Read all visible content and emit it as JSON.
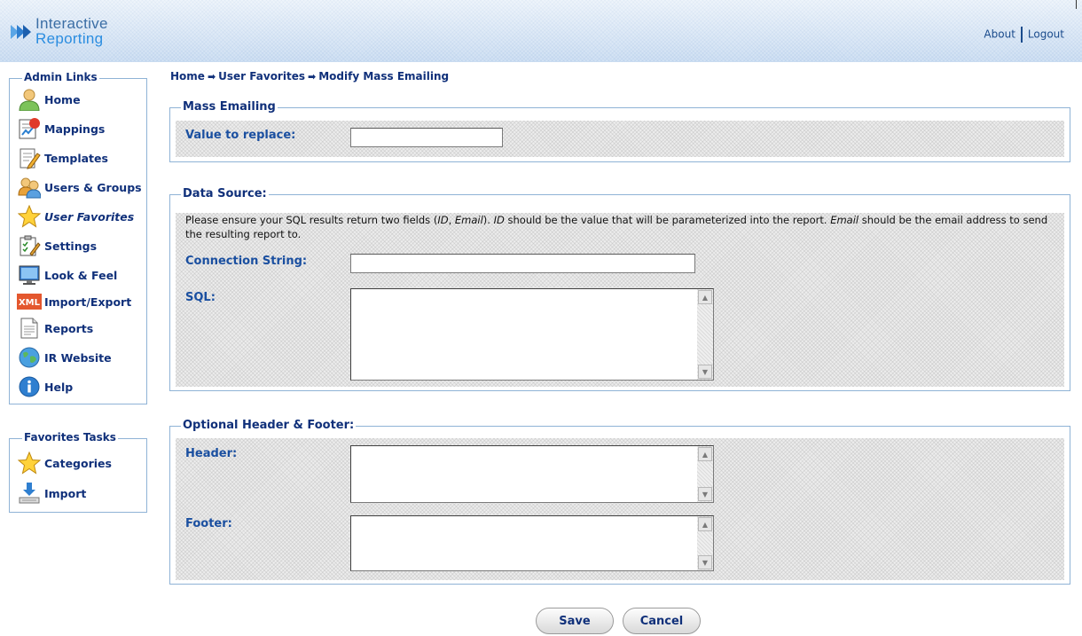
{
  "header": {
    "logo_line1": "Interactive",
    "logo_line2": "Reporting",
    "about": "About",
    "logout": "Logout"
  },
  "sidebar": {
    "admin_title": "Admin Links",
    "admin_items": [
      {
        "label": "Home",
        "icon": "user-icon"
      },
      {
        "label": "Mappings",
        "icon": "mappings-icon"
      },
      {
        "label": "Templates",
        "icon": "templates-icon"
      },
      {
        "label": "Users & Groups",
        "icon": "users-groups-icon"
      },
      {
        "label": "User Favorites",
        "icon": "star-icon",
        "active": true
      },
      {
        "label": "Settings",
        "icon": "settings-icon"
      },
      {
        "label": "Look & Feel",
        "icon": "monitor-icon"
      },
      {
        "label": "Import/Export",
        "icon": "xml-icon"
      },
      {
        "label": "Reports",
        "icon": "report-icon"
      },
      {
        "label": "IR Website",
        "icon": "globe-icon"
      },
      {
        "label": "Help",
        "icon": "info-icon"
      }
    ],
    "favorites_title": "Favorites Tasks",
    "favorites_items": [
      {
        "label": "Categories",
        "icon": "star-icon"
      },
      {
        "label": "Import",
        "icon": "import-icon"
      }
    ]
  },
  "breadcrumb": {
    "home": "Home",
    "user_favorites": "User Favorites",
    "current": "Modify Mass Emailing",
    "separator": "➡"
  },
  "mass_emailing": {
    "legend": "Mass Emailing",
    "value_label": "Value to replace:",
    "value": ""
  },
  "data_source": {
    "legend": "Data Source:",
    "note_part1": "Please ensure your SQL results return two fields (",
    "note_id": "ID",
    "note_comma": ", ",
    "note_email": "Email",
    "note_part2": "). ",
    "note_id2": "ID",
    "note_part3": " should be the value that will be parameterized into the report. ",
    "note_email2": "Email",
    "note_part4": " should be the email address to send the resulting report to.",
    "connection_label": "Connection String:",
    "connection_value": "",
    "sql_label": "SQL:",
    "sql_value": ""
  },
  "header_footer": {
    "legend": "Optional Header & Footer:",
    "header_label": "Header:",
    "header_value": "",
    "footer_label": "Footer:",
    "footer_value": ""
  },
  "buttons": {
    "save": "Save",
    "cancel": "Cancel"
  },
  "colors": {
    "accent": "#10307a",
    "label": "#1a4fa0",
    "border": "#8fb3d6"
  }
}
